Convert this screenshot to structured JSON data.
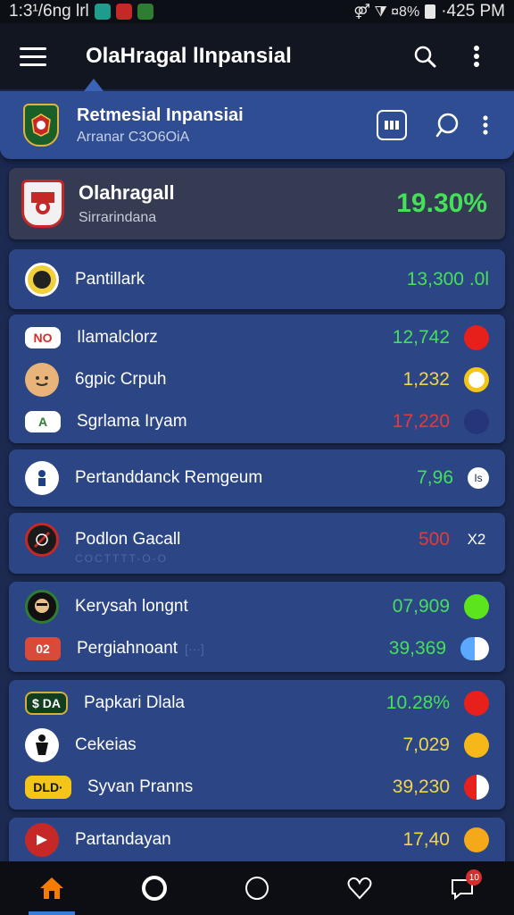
{
  "status_bar": {
    "left_text": "1:3¹/6ng lrl",
    "right_text": "·425 PM",
    "signal_text": "⚤ ⧩ ¤8%"
  },
  "app_bar": {
    "title": "OlaHragal lInpansial"
  },
  "sub_header": {
    "title": "Retmesial Inpansiai",
    "subtitle": "Arranar C3O6OiA"
  },
  "featured": {
    "name": "Olahragall",
    "sub": "Sirrarindana",
    "value": "19.30%"
  },
  "single_row": {
    "name": "Pantillark",
    "value": "13,300 .0l"
  },
  "group1": [
    {
      "name": "Ilamalclorz",
      "value": "12,742",
      "logo": "NO"
    },
    {
      "name": "6gpic Crpuh",
      "value": "1,232",
      "logo": ""
    },
    {
      "name": "Sgrlama Iryam",
      "value": "17,220",
      "logo": "A"
    }
  ],
  "row_mid": {
    "name": "Pertanddanck Remgeum",
    "value": "7,96",
    "badge": "Is"
  },
  "row_red": {
    "name": "Podlon Gacall",
    "value": "500",
    "badge": "X2",
    "faded": "COCTTTT-O-O"
  },
  "group2": [
    {
      "name": "Kerysah longnt",
      "value": "07,909",
      "logo": ""
    },
    {
      "name": "Pergiahnoant",
      "value": "39,369",
      "logo": "02",
      "faded": "[···]"
    }
  ],
  "group3": [
    {
      "name": "Papkari Dlala",
      "value": "10.28%",
      "logo": "$ DA"
    },
    {
      "name": "Cekeias",
      "value": "7,029",
      "logo": ""
    },
    {
      "name": "Syvan Pranns",
      "value": "39,230",
      "logo": "DLD·"
    }
  ],
  "last_row": {
    "name": "Partandayan",
    "value": "17,40"
  },
  "bottom_nav": {
    "badge": "10"
  },
  "colors": {
    "green": "#45e05a",
    "yellow": "#f2d64a",
    "red": "#e23b3b",
    "accent": "#2f4d93"
  }
}
